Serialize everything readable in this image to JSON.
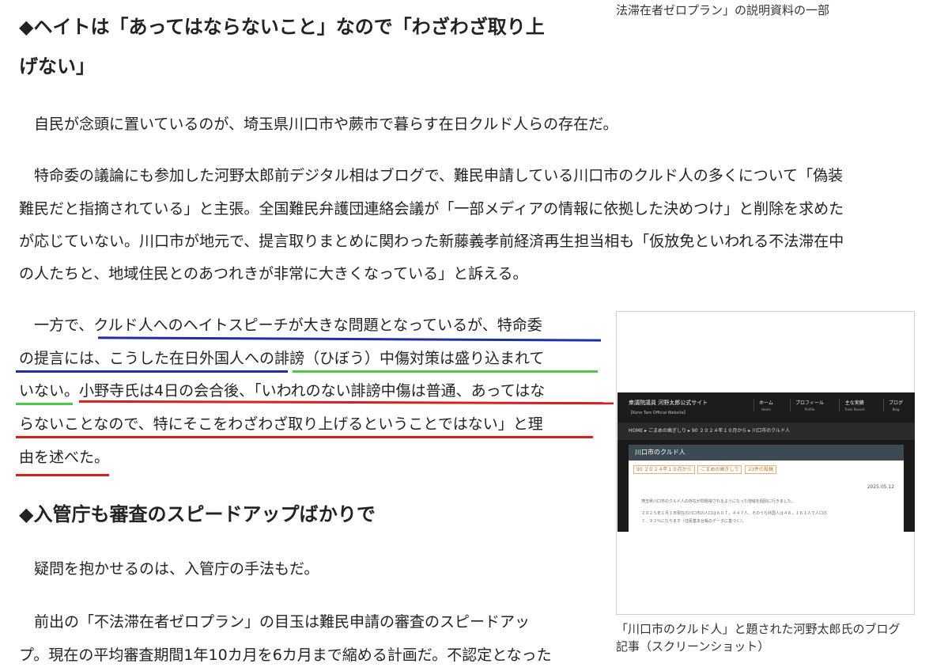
{
  "top_caption": "法滞在者ゼロプラン」の説明資料の一部",
  "headings": {
    "h1_line1": "◆ヘイトは「あってはならないこと」なので「わざわざ取り上",
    "h1_line2": "げない」",
    "h2": "◆入管庁も審査のスピードアップばかりで"
  },
  "paragraphs": {
    "p1": [
      "　自民が念頭に置いているのが、埼玉県川口市や蕨市で暮らす在日クルド人らの存在だ。"
    ],
    "p2": [
      "　特命委の議論にも参加した河野太郎前デジタル相はブログで、難民申請している川口市のクルド人の多くについて「偽装",
      "難民だと指摘されている」と主張。全国難民弁護団連絡会議が「一部メディアの情報に依拠した決めつけ」と削除を求めた",
      "が応じていない。川口市が地元で、提言取りまとめに関わった新藤義孝前経済再生担当相も「仮放免といわれる不法滞在中",
      "の人たちと、地域住民とのあつれきが非常に大きくなっている」と訴える。"
    ],
    "p3": [
      "　一方で、クルド人へのヘイトスピーチが大きな問題となっているが、特命委",
      "の提言には、こうした在日外国人への誹謗（ひぼう）中傷対策は盛り込まれて",
      "いない。小野寺氏は4日の会合後、「いわれのない誹謗中傷は普通、あってはな",
      "らないことなので、特にそこをわざわざ取り上げるということではない」と理",
      "由を述べた。"
    ],
    "p4": [
      "　疑問を抱かせるのは、入管庁の手法もだ。"
    ],
    "p5": [
      "　前出の「不法滞在者ゼロプラン」の目玉は難民申請の審査のスピードアッ",
      "プ。現在の平均審査期間1年10カ月を6カ月まで縮める計画だ。不認定となった"
    ]
  },
  "figure": {
    "site_name": "衆議院議員 河野太郎公式サイト",
    "site_sub": "【Kono Taro Official Website】",
    "nav": [
      {
        "label": "ホーム",
        "sub": "Home"
      },
      {
        "label": "プロフィール",
        "sub": "Profile"
      },
      {
        "label": "主な実績",
        "sub": "Track Record"
      },
      {
        "label": "ブログ",
        "sub": "Blog"
      }
    ],
    "breadcrumb": "HOME ▸ ごまめの歯ぎしり ▸ 90 ２０２４年１０月から ▸ 川口市のクルド人",
    "post_title": "川口市のクルド人",
    "tags": [
      "90 ２０２４年１０月から",
      "ごまめの歯ぎしり",
      "23件の投稿"
    ],
    "date": "2025.05.12",
    "text_lines": [
      "埼玉県川口市のクルド人の存在が問題視されるようになった地域を個別に行きました。",
      "２０２５年１月１日現在の川口市の人口は６０７，４４７人、そのうち外国人は４８，１６１人で人口の",
      "７．９３％になります（住民基本台帳のデータに基づく）。"
    ],
    "caption_line1": "「川口市のクルド人」と題された河野太郎氏のブログ",
    "caption_line2": "記事（スクリーンショット）"
  },
  "colors": {
    "underline_blue": "#1f2fa8",
    "underline_green": "#4ac94a",
    "underline_red": "#d81f1f"
  }
}
